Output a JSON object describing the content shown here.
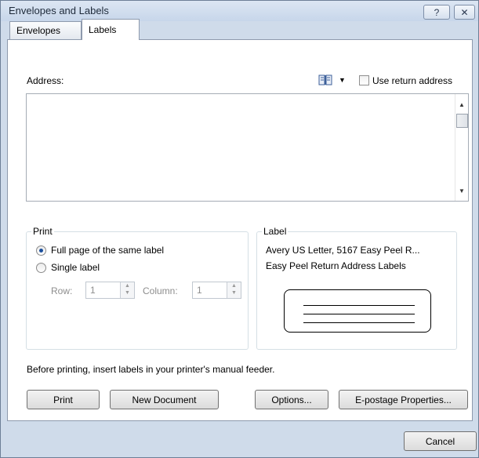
{
  "window": {
    "title": "Envelopes and Labels",
    "help_glyph": "?",
    "close_glyph": "✕"
  },
  "tabs": [
    {
      "label": "Envelopes",
      "active": false
    },
    {
      "label": "Labels",
      "active": true
    }
  ],
  "address": {
    "label": "Address:",
    "value": "",
    "use_return_address_label": "Use return address",
    "use_return_address_checked": false
  },
  "print_group": {
    "title": "Print",
    "options": [
      {
        "label": "Full page of the same label",
        "selected": true
      },
      {
        "label": "Single label",
        "selected": false
      }
    ],
    "row_label": "Row:",
    "row_value": "1",
    "column_label": "Column:",
    "column_value": "1"
  },
  "label_group": {
    "title": "Label",
    "line1": "Avery US Letter, 5167 Easy Peel R...",
    "line2": "Easy Peel Return Address Labels"
  },
  "feeder_instruction": "Before printing, insert labels in your printer's manual feeder.",
  "buttons": {
    "print": "Print",
    "new_document": "New Document",
    "options": "Options...",
    "epostage": "E-postage Properties...",
    "cancel": "Cancel"
  }
}
